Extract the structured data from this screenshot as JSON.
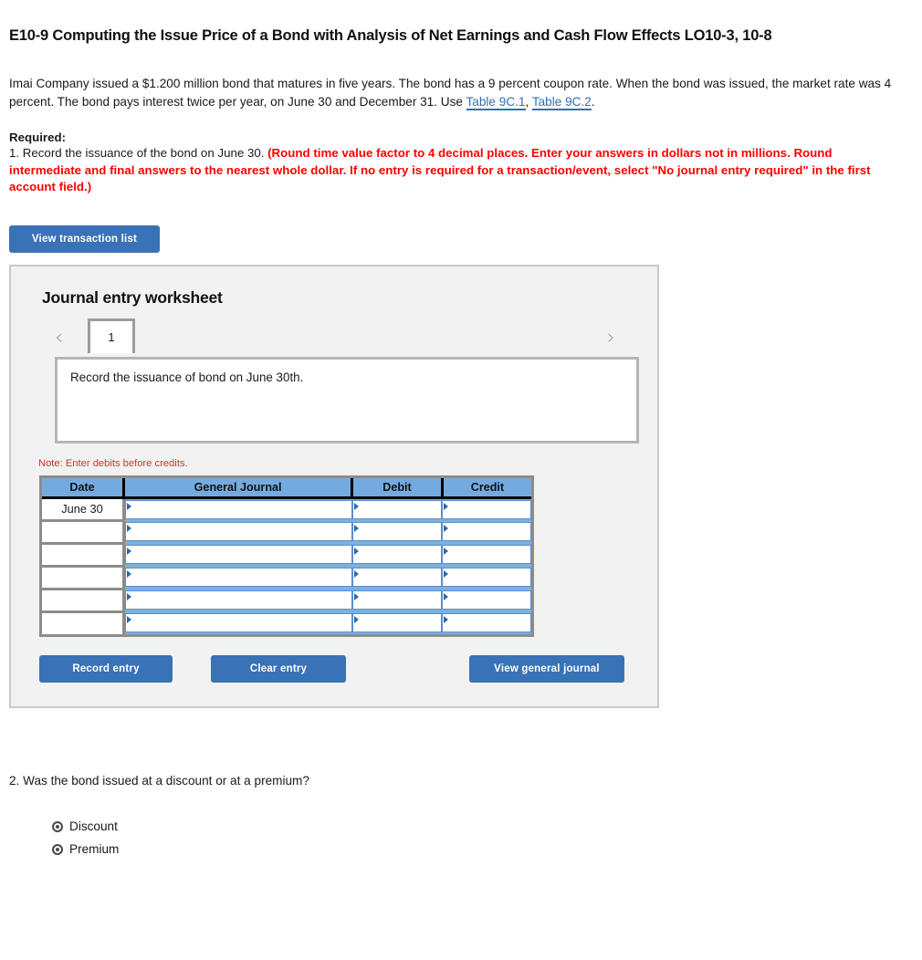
{
  "title": "E10-9 Computing the Issue Price of a Bond with Analysis of Net Earnings and Cash Flow Effects LO10-3, 10-8",
  "statement": {
    "part1": "Imai Company issued a $1.200 million bond that matures in five years. The bond has a 9 percent coupon rate. When the bond was issued, the market rate was 4 percent. The bond pays interest twice per year, on June 30 and December 31. Use ",
    "link1": "Table 9C.1",
    "separator": ", ",
    "link2": "Table 9C.2",
    "part2": "."
  },
  "required": {
    "label": "Required:",
    "item_plain": "1. Record the issuance of the bond on June 30. ",
    "item_red": "(Round time value factor to 4 decimal places. Enter your answers in dollars not in millions. Round intermediate and final answers to the nearest whole dollar. If no entry is required for a transaction/event, select \"No journal entry required\" in the first account field.)"
  },
  "buttons": {
    "view_transaction_list": "View transaction list",
    "record_entry": "Record entry",
    "clear_entry": "Clear entry",
    "view_general_journal": "View general journal"
  },
  "worksheet": {
    "heading": "Journal entry worksheet",
    "pager": {
      "prev_icon": "‹",
      "next_icon": "›",
      "current_tab": "1"
    },
    "description": "Record the issuance of bond on June 30th.",
    "note": "Note: Enter debits before credits.",
    "table": {
      "headers": [
        "Date",
        "General Journal",
        "Debit",
        "Credit"
      ],
      "rows": [
        {
          "date": "June 30",
          "general_journal": "",
          "debit": "",
          "credit": ""
        },
        {
          "date": "",
          "general_journal": "",
          "debit": "",
          "credit": ""
        },
        {
          "date": "",
          "general_journal": "",
          "debit": "",
          "credit": ""
        },
        {
          "date": "",
          "general_journal": "",
          "debit": "",
          "credit": ""
        },
        {
          "date": "",
          "general_journal": "",
          "debit": "",
          "credit": ""
        },
        {
          "date": "",
          "general_journal": "",
          "debit": "",
          "credit": ""
        }
      ]
    }
  },
  "question2": {
    "text": "2. Was the bond issued at a discount or at a premium?",
    "options": [
      {
        "label": "Discount",
        "selected": false
      },
      {
        "label": "Premium",
        "selected": false
      }
    ]
  },
  "colors": {
    "button_blue": "#3a72b8",
    "table_header_blue": "#74aae0",
    "link_blue": "#2f6fb5",
    "alert_red": "#ff0000",
    "note_red": "#c0392b",
    "panel_gray": "#f2f2f2"
  }
}
